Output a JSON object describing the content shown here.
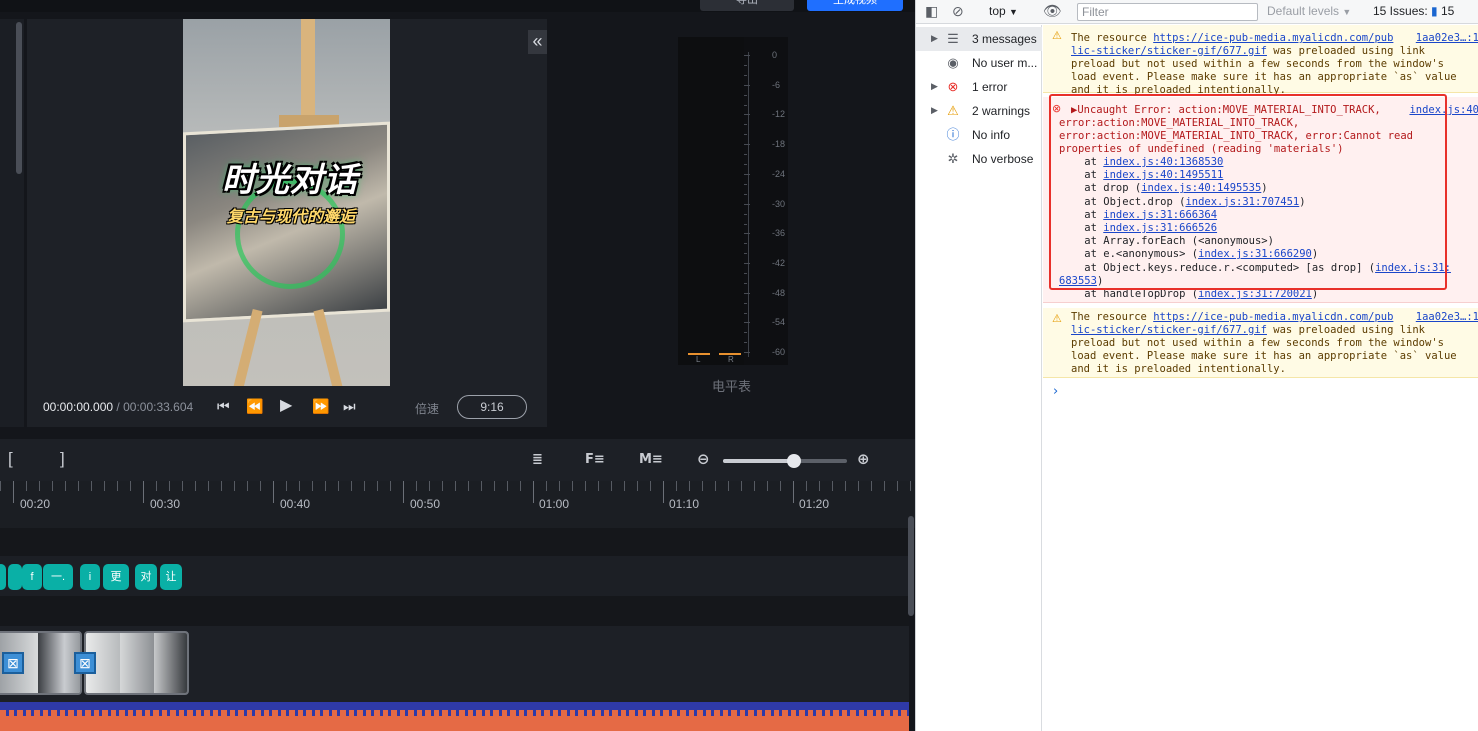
{
  "editor": {
    "top_buttons": {
      "secondary_label": "导出",
      "primary_label": "生成视频"
    },
    "video": {
      "title": "时光对话",
      "subtitle": "复古与现代的邂逅"
    },
    "player": {
      "current_time": "00:00:00.000",
      "separator": " / ",
      "duration": "00:00:33.604",
      "speed_label": "倍速",
      "aspect_ratio": "9:16"
    },
    "level_meter": {
      "caption": "电平表",
      "scale": [
        "0",
        "-6",
        "-12",
        "-18",
        "-24",
        "-30",
        "-36",
        "-42",
        "-48",
        "-54",
        "-60"
      ],
      "left_label": "L",
      "right_label": "R"
    },
    "timeline": {
      "bracket_open": "[",
      "bracket_close": "]",
      "ruler_labels": [
        "00:20",
        "00:30",
        "00:40",
        "00:50",
        "01:00",
        "01:10",
        "01:20"
      ],
      "text_chips": [
        "",
        "",
        "f",
        "一.",
        "i",
        "更",
        "对",
        "让"
      ],
      "zoom_level": 0.57
    }
  },
  "devtools": {
    "toolbar": {
      "context": "top",
      "filter_placeholder": "Filter",
      "levels": "Default levels",
      "issues_label": "15 Issues:",
      "issues_count": "15"
    },
    "sidebar": [
      {
        "label": "3 messages",
        "icon": "list-icon",
        "arrow": true
      },
      {
        "label": "No user m...",
        "icon": "user-icon",
        "arrow": false
      },
      {
        "label": "1 error",
        "icon": "error-icon",
        "arrow": true
      },
      {
        "label": "2 warnings",
        "icon": "warning-icon",
        "arrow": true
      },
      {
        "label": "No info",
        "icon": "info-icon",
        "arrow": false
      },
      {
        "label": "No verbose",
        "icon": "bug-icon",
        "arrow": false
      }
    ],
    "warning1": {
      "prefix": "The resource ",
      "url1": "https://ice-pub-media.myalicdn.com/pub",
      "url2": "lic-sticker/sticker-gif/677.gif",
      "rest1": " was preloaded using link",
      "line3": "preload but not used within a few seconds from the window's",
      "line4": "load event. Please make sure it has an appropriate `as` value",
      "line5": "and it is preloaded intentionally.",
      "source": "1aa02e3…:1"
    },
    "error": {
      "line1": "▶Uncaught Error: action:MOVE_MATERIAL_INTO_TRACK,",
      "source": "index.js:40",
      "line2": "error:action:MOVE_MATERIAL_INTO_TRACK,",
      "line3": "error:action:MOVE_MATERIAL_INTO_TRACK, error:Cannot read",
      "line4": "properties of undefined (reading 'materials')",
      "stack": [
        {
          "pre": "    at ",
          "link": "index.js:40:1368530",
          "post": ""
        },
        {
          "pre": "    at ",
          "link": "index.js:40:1495511",
          "post": ""
        },
        {
          "pre": "    at drop (",
          "link": "index.js:40:1495535",
          "post": ")"
        },
        {
          "pre": "    at Object.drop (",
          "link": "index.js:31:707451",
          "post": ")"
        },
        {
          "pre": "    at ",
          "link": "index.js:31:666364",
          "post": ""
        },
        {
          "pre": "    at ",
          "link": "index.js:31:666526",
          "post": ""
        },
        {
          "pre": "    at Array.forEach (<anonymous>)",
          "link": "",
          "post": ""
        },
        {
          "pre": "    at e.<anonymous> (",
          "link": "index.js:31:666290",
          "post": ")"
        },
        {
          "pre": "    at Object.keys.reduce.r.<computed> [as drop] (",
          "link": "index.js:31:",
          "post": ""
        },
        {
          "pre": "",
          "link": "683553",
          "post": ")"
        },
        {
          "pre": "    at handleTopDrop (",
          "link": "index.js:31:720021",
          "post": ")"
        }
      ]
    },
    "warning2": {
      "prefix": "The resource ",
      "url1": "https://ice-pub-media.myalicdn.com/pub",
      "url2": "lic-sticker/sticker-gif/677.gif",
      "rest1": " was preloaded using link",
      "line3": "preload but not used within a few seconds from the window's",
      "line4": "load event. Please make sure it has an appropriate `as` value",
      "line5": "and it is preloaded intentionally.",
      "source": "1aa02e3…:1"
    },
    "prompt": "›"
  },
  "colors": {
    "accent_blue": "#1f6fff",
    "teal_chip": "#0ab0a6",
    "error_red": "#e8302a",
    "audio_wave": "#e56a45"
  }
}
